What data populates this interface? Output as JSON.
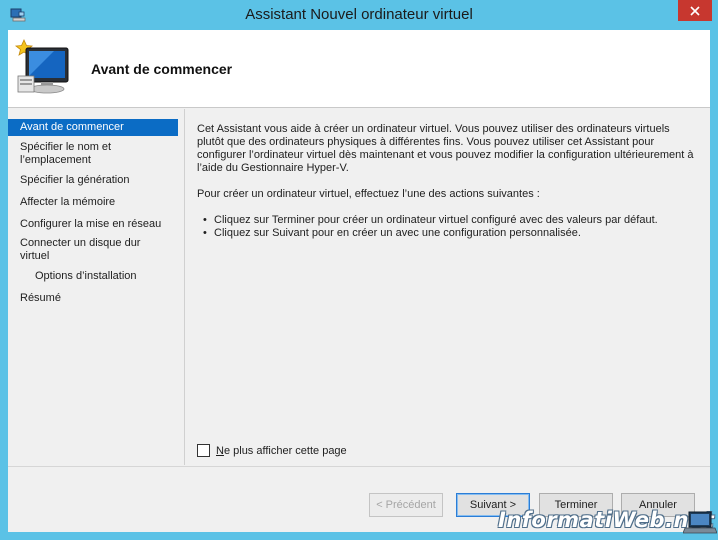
{
  "window": {
    "title": "Assistant Nouvel ordinateur virtuel",
    "close_icon": "close-icon"
  },
  "header": {
    "title": "Avant de commencer",
    "icon": "virtual-machine-wizard-icon"
  },
  "nav": {
    "items": [
      {
        "label": "Avant de commencer",
        "active": true
      },
      {
        "label": "Spécifier le nom et l’emplacement"
      },
      {
        "label": "Spécifier la génération"
      },
      {
        "label": "Affecter la mémoire"
      },
      {
        "label": "Configurer la mise en réseau"
      },
      {
        "label": "Connecter un disque dur virtuel"
      },
      {
        "label": "Options d’installation",
        "sub": true
      },
      {
        "label": "Résumé"
      }
    ]
  },
  "content": {
    "intro": "Cet Assistant vous aide à créer un ordinateur virtuel. Vous pouvez utiliser des ordinateurs virtuels plutôt que des ordinateurs physiques à différentes fins. Vous pouvez utiliser cet Assistant pour configurer l’ordinateur virtuel dès maintenant et vous pouvez modifier la configuration ultérieurement à l’aide du Gestionnaire Hyper-V.",
    "actions_intro": "Pour créer un ordinateur virtuel, effectuez l’une des actions suivantes :",
    "bullets": [
      "Cliquez sur Terminer pour créer un ordinateur virtuel configuré avec des valeurs par défaut.",
      "Cliquez sur Suivant pour en créer un avec une configuration personnalisée."
    ]
  },
  "checkbox": {
    "label": "Ne plus afficher cette page",
    "checked": false
  },
  "buttons": {
    "previous": "< Précédent",
    "next": "Suivant >",
    "finish": "Terminer",
    "cancel": "Annuler"
  },
  "watermark": {
    "text": "InformatiWeb.net"
  },
  "colors": {
    "frame": "#5bc2e6",
    "close": "#c7372f",
    "selection": "#0b6cc5"
  }
}
